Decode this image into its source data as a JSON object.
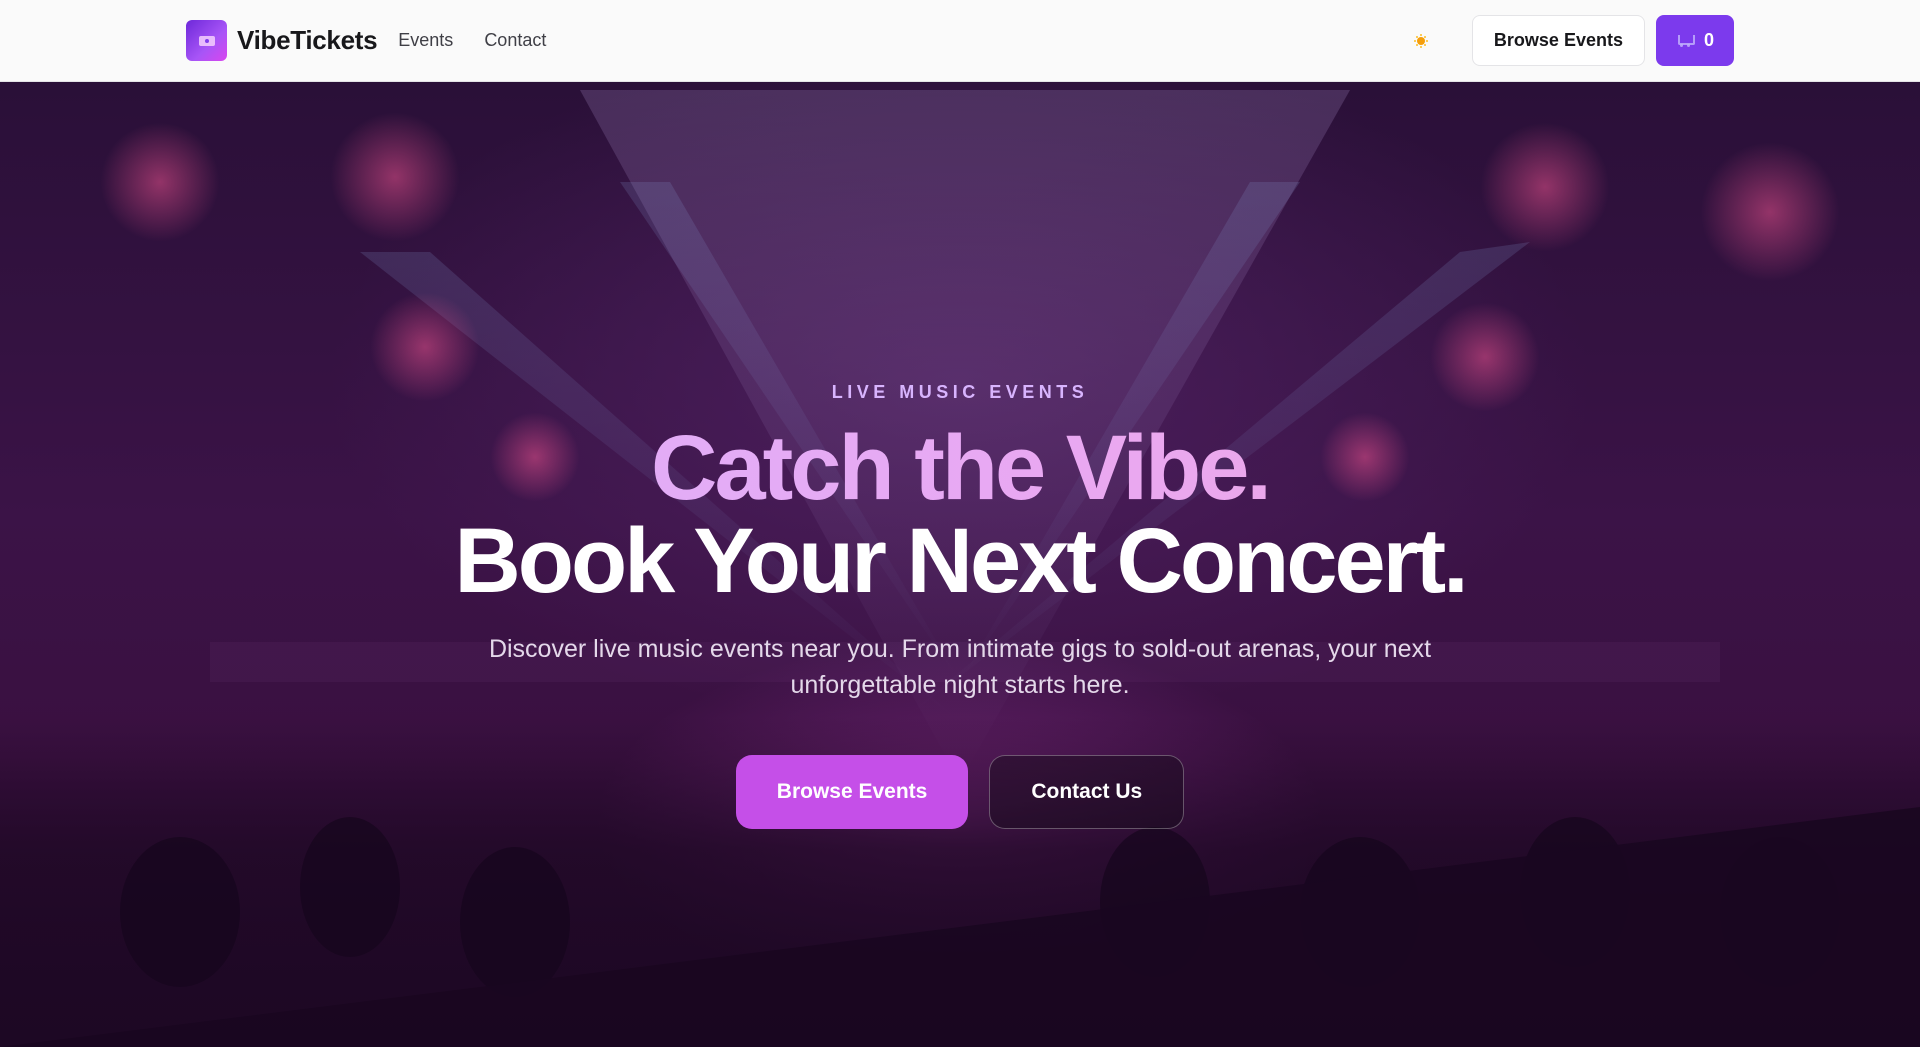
{
  "nav": {
    "brand": "VibeTickets",
    "links": [
      "Events",
      "Contact"
    ],
    "browse_label": "Browse Events",
    "cart_count": "0"
  },
  "hero": {
    "eyebrow": "LIVE MUSIC EVENTS",
    "headline_line1": "Catch the Vibe.",
    "headline_line2": "Book Your Next Concert.",
    "subtext": "Discover live music events near you. From intimate gigs to sold-out arenas, your next unforgettable night starts here.",
    "primary_cta": "Browse Events",
    "secondary_cta": "Contact Us"
  },
  "colors": {
    "accent": "#7c3aed",
    "primary_cta": "#c54fe8",
    "eyebrow": "#d8b4fe"
  },
  "icons": {
    "logo": "ticket-icon",
    "theme_toggle": "sun-icon",
    "cart": "cart-icon"
  }
}
